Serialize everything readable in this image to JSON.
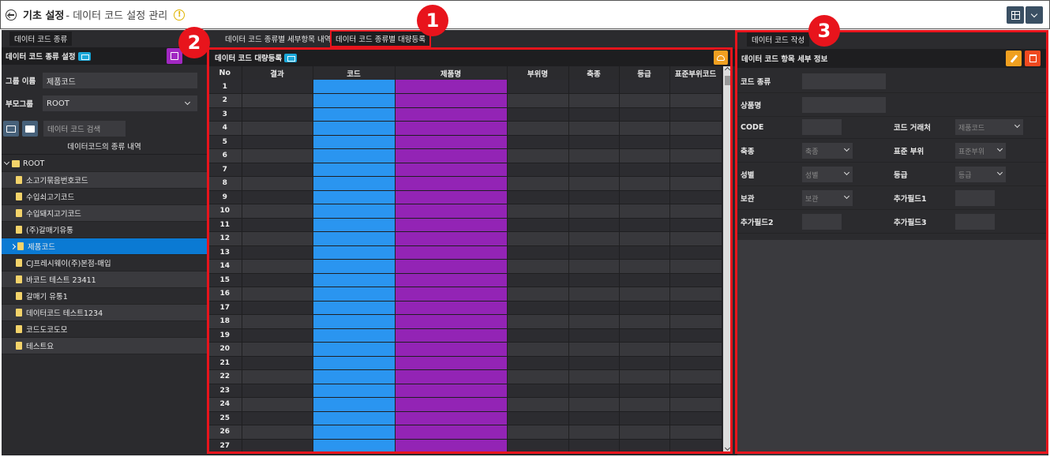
{
  "window": {
    "title_main": "기초 설정",
    "title_sub": "- 데이터 코드 설정 관리"
  },
  "left": {
    "tab_label": "데이터 코드 종류",
    "section_title": "데이터 코드 종류 설정",
    "group_name_label": "그룹 이름",
    "group_name_value": "제품코드",
    "parent_group_label": "부모그룹",
    "parent_group_value": "ROOT",
    "search_placeholder": "데이터 코드 검색",
    "tree_caption": "데이터코드의 종류 내역",
    "tree_root": "ROOT",
    "tree_items": [
      "소고기묶음번호코드",
      "수입쇠고기코드",
      "수입돼지고기코드",
      "(주)갈매기유통",
      "제품코드",
      "CJ프레시웨이(주)본점-매입",
      "바코드 테스트 23411",
      "갈매기 유통1",
      "데이터코드 테스트1234",
      "코드도코도모",
      "테스트요"
    ],
    "selected_index": 4
  },
  "middle": {
    "tab1": "데이터 코드 종류별 세부항목 내역",
    "tab2": "데이터 코드 종류별 대량등록",
    "grid_title": "데이터 코드 대량등록",
    "columns": [
      "No",
      "결과",
      "코드",
      "제품명",
      "부위명",
      "축종",
      "등급",
      "표준부위코드"
    ],
    "row_count": 27
  },
  "right": {
    "tab_label": "데이터 코드 작성",
    "section_title": "데이터 코드 항목 세부 정보",
    "fields": {
      "code_type": "코드 종류",
      "product_name": "상품명",
      "code": "CODE",
      "code_vendor": "코드 거래처",
      "code_vendor_value": "제품코드",
      "species": "축종",
      "species_ph": "축종",
      "std_part": "표준 부위",
      "std_part_ph": "표준부위",
      "gender": "성별",
      "gender_ph": "성별",
      "grade": "등급",
      "grade_ph": "등급",
      "storage": "보관",
      "storage_ph": "보관",
      "extra1": "추가필드1",
      "extra2": "추가필드2",
      "extra3": "추가필드3"
    }
  },
  "markers": [
    "1",
    "2",
    "3"
  ],
  "colors": {
    "code_column": "#2a95f0",
    "product_column": "#9324b5",
    "selected_row": "#0b7ad3",
    "annotation_red": "#e8141c",
    "upload_button": "#f0a020",
    "delete_button": "#f04a20"
  }
}
